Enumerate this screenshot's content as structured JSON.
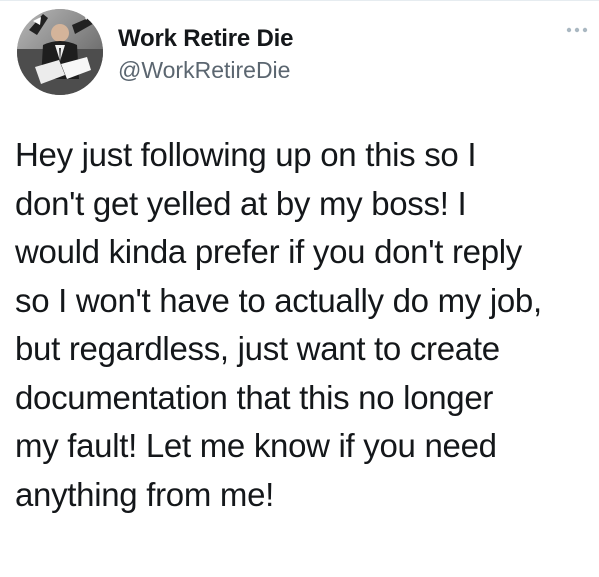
{
  "author": {
    "display_name": "Work Retire Die",
    "handle": "@WorkRetireDie",
    "avatar_icon": "man-in-suit-throwing-papers-avatar",
    "more_icon": "more-options-icon"
  },
  "tweet": {
    "text": "Hey just following up on this so I\ndon't get yelled at by my boss! I\nwould kinda prefer if you don't reply\nso I won't have to actually do my job,\nbut regardless, just want to create\ndocumentation that this no longer\nmy fault! Let me know if you need\nanything from me!"
  },
  "colors": {
    "background": "#ffffff",
    "text_primary": "#14171a",
    "text_secondary": "#5b6670",
    "icon_muted": "#aab8c2"
  }
}
